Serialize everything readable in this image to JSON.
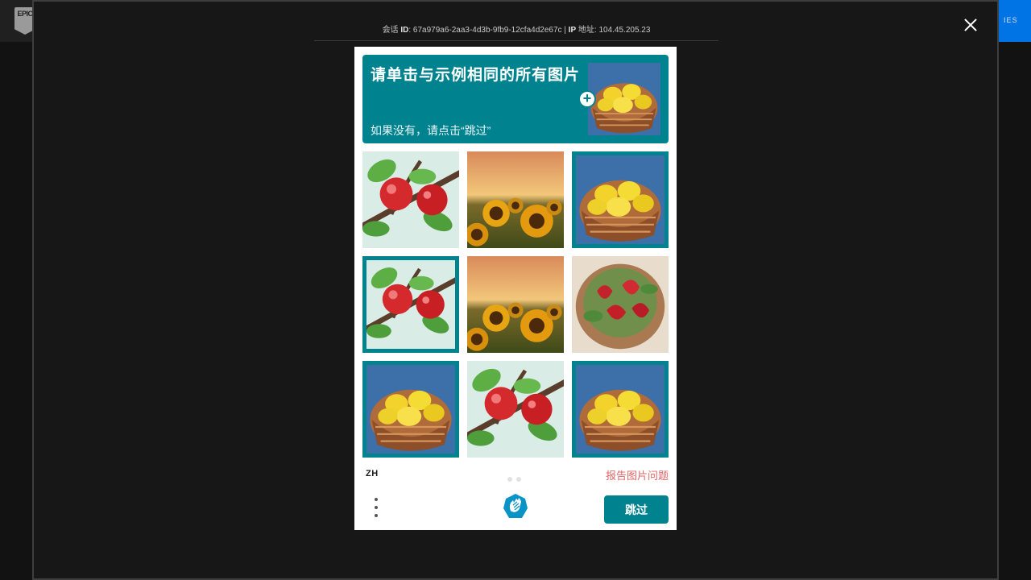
{
  "site": {
    "logo_text": "EPIC",
    "cta_label": "IES"
  },
  "modal": {
    "info": {
      "id_prefix": "会话",
      "id_label": "ID",
      "id_value": "67a979a6-2aa3-4d3b-9fb9-12cfa4d2e67c",
      "ip_label": "IP",
      "ip_suffix": "地址",
      "ip_value": "104.45.205.23"
    }
  },
  "captcha": {
    "title": "请单击与示例相同的所有图片",
    "subtitle": "如果没有，请点击“跳过”",
    "example_subject": "lemons-in-basket",
    "tiles": [
      {
        "subject": "apples-on-branch",
        "selected": false
      },
      {
        "subject": "sunflower-field-sunset",
        "selected": false
      },
      {
        "subject": "lemons-in-basket",
        "selected": true
      },
      {
        "subject": "apples-on-branch",
        "selected": true
      },
      {
        "subject": "sunflower-field-sunset",
        "selected": false
      },
      {
        "subject": "strawberries-in-bowl",
        "selected": false
      },
      {
        "subject": "lemons-in-basket",
        "selected": true
      },
      {
        "subject": "apples-on-branch",
        "selected": false
      },
      {
        "subject": "lemons-in-basket",
        "selected": true
      }
    ],
    "language": "ZH",
    "report_label": "报告图片问题",
    "submit_label": "跳过",
    "page_count": 2,
    "colors": {
      "accent": "#00838f",
      "report": "#e06666"
    }
  }
}
